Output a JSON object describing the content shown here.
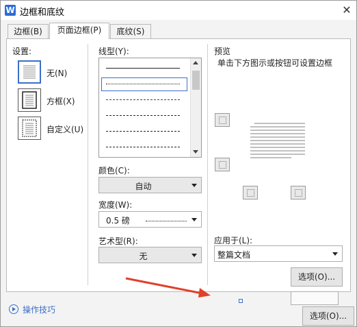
{
  "window": {
    "title": "边框和底纹",
    "app_icon": "W"
  },
  "tabs": [
    {
      "label": "边框(B)",
      "active": false
    },
    {
      "label": "页面边框(P)",
      "active": true
    },
    {
      "label": "底纹(S)",
      "active": false
    }
  ],
  "settings": {
    "label": "设置:",
    "items": [
      {
        "label": "无(N)",
        "icon": "border-none-icon"
      },
      {
        "label": "方框(X)",
        "icon": "border-box-icon"
      },
      {
        "label": "自定义(U)",
        "icon": "border-custom-icon"
      }
    ]
  },
  "line_style": {
    "label": "线型(Y):",
    "styles": [
      "solid",
      "dotted",
      "dashed-small",
      "dashed",
      "dash-dot",
      "dash-dot-dot"
    ],
    "selected_index": 1
  },
  "color": {
    "label": "颜色(C):",
    "value": "自动"
  },
  "width": {
    "label": "宽度(W):",
    "value": "0.5 磅"
  },
  "art": {
    "label": "艺术型(R):",
    "value": "无"
  },
  "preview": {
    "label": "预览",
    "hint": "单击下方图示或按钮可设置边框"
  },
  "apply_to": {
    "label": "应用于(L):",
    "value": "整篇文档"
  },
  "buttons": {
    "options_inner": "选项(O)...",
    "options_outer": "选项(O)..."
  },
  "footer": {
    "tips_label": "操作技巧"
  },
  "colors": {
    "accent": "#3a6fc9",
    "annotation_arrow": "#e0402a",
    "app_icon": "#2b6cd6"
  }
}
